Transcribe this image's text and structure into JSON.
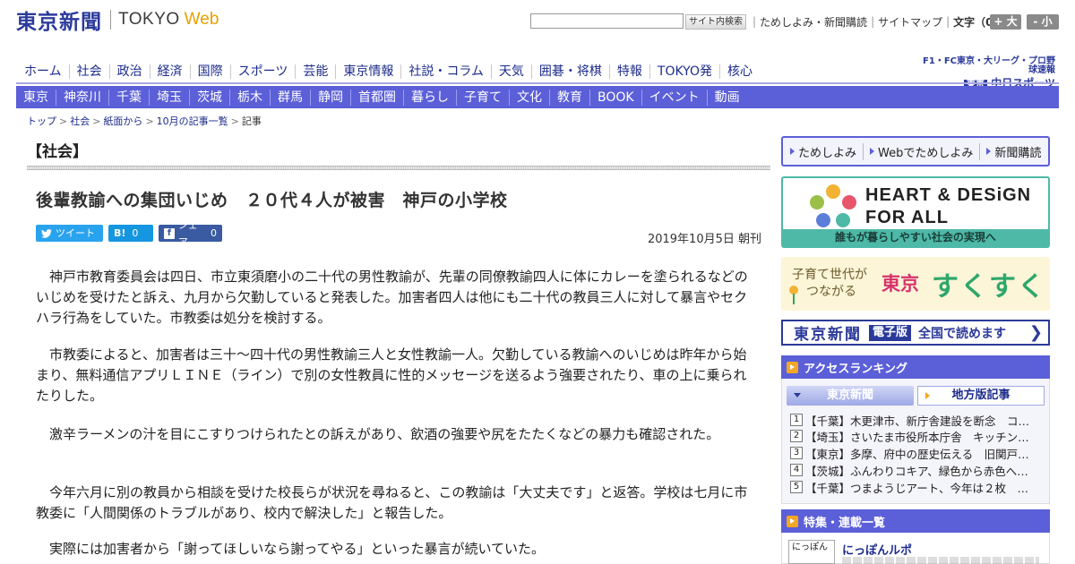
{
  "header": {
    "logo_jp": "東京新聞",
    "logo_en": "TOKYO",
    "logo_web": "Web",
    "search_button": "サイト内検索",
    "links": [
      "ためしよみ・新聞購読",
      "サイトマップ"
    ],
    "font_label": "文字（0）",
    "font_plus": "+ 大",
    "font_minus": "- 小"
  },
  "nav_main": [
    "ホーム",
    "社会",
    "政治",
    "経済",
    "国際",
    "スポーツ",
    "芸能",
    "東京情報",
    "社説・コラム",
    "天気",
    "囲碁・将棋",
    "特報",
    "TOKYO発",
    "核心"
  ],
  "chunichi": {
    "top": "F1・FC東京・大リーグ・プロ野球速報",
    "brand_prefix": "東京",
    "brand": "中日スポーツ"
  },
  "nav_region": [
    "東京",
    "神奈川",
    "千葉",
    "埼玉",
    "茨城",
    "栃木",
    "群馬",
    "静岡",
    "首都圏",
    "暮らし",
    "子育て",
    "文化",
    "教育",
    "BOOK",
    "イベント",
    "動画"
  ],
  "breadcrumb": [
    "トップ",
    "社会",
    "紙面から",
    "10月の記事一覧",
    "記事"
  ],
  "article": {
    "section": "【社会】",
    "headline": "後輩教諭への集団いじめ　２０代４人が被害　神戸の小学校",
    "tweet_label": "ツイート",
    "hatena_label": "B!",
    "hatena_count": "0",
    "share_label": "シェア",
    "share_count": "0",
    "date": "2019年10月5日 朝刊",
    "paragraphs": [
      "神戸市教育委員会は四日、市立東須磨小の二十代の男性教諭が、先輩の同僚教諭四人に体にカレーを塗られるなどのいじめを受けたと訴え、九月から欠勤していると発表した。加害者四人は他にも二十代の教員三人に対して暴言やセクハラ行為をしていた。市教委は処分を検討する。",
      "市教委によると、加害者は三十～四十代の男性教諭三人と女性教諭一人。欠勤している教諭へのいじめは昨年から始まり、無料通信アプリＬＩＮＥ（ライン）で別の女性教員に性的メッセージを送るよう強要されたり、車の上に乗られたりした。",
      "激辛ラーメンの汁を目にこすりつけられたとの訴えがあり、飲酒の強要や尻をたたくなどの暴力も確認された。",
      "今年六月に別の教員から相談を受けた校長らが状況を尋ねると、この教諭は「大丈夫です」と返答。学校は七月に市教委に「人間関係のトラブルがあり、校内で解決した」と報告した。",
      "実際には加害者から「謝ってほしいなら謝ってやる」といった暴言が続いていた。"
    ]
  },
  "sidebar": {
    "tameshi": [
      "ためしよみ",
      "Webでためしよみ",
      "新聞購読"
    ],
    "heart_line1": "HEART & DESiGN",
    "heart_line2": "FOR ALL",
    "heart_caption": "誰もが暮らしやすい社会の実現へ",
    "suku_line1": "子育て世代が",
    "suku_line2": "つながる",
    "suku_tokyo": "東京",
    "suku_brand": "すくすく",
    "denshi_name": "東京新聞",
    "denshi_badge": "電子版",
    "denshi_text": "全国で読めます",
    "ranking_title": "アクセスランキング",
    "ranking_tab1": "東京新聞",
    "ranking_tab2": "地方版記事",
    "ranking": [
      {
        "n": "1",
        "t": "【千葉】木更津市、新庁舎建設を断念　コ…"
      },
      {
        "n": "2",
        "t": "【埼玉】さいたま市役所本庁舎　キッチン…"
      },
      {
        "n": "3",
        "t": "【東京】多摩、府中の歴史伝える　旧関戸…"
      },
      {
        "n": "4",
        "t": "【茨城】ふんわりコキア、緑色から赤色へ…"
      },
      {
        "n": "5",
        "t": "【千葉】つまようじアート、今年は２枚　…"
      }
    ],
    "tokushu_title": "特集・連載一覧",
    "nippon_thumb": "にっぽん",
    "nippon_title": "にっぽんルポ"
  }
}
